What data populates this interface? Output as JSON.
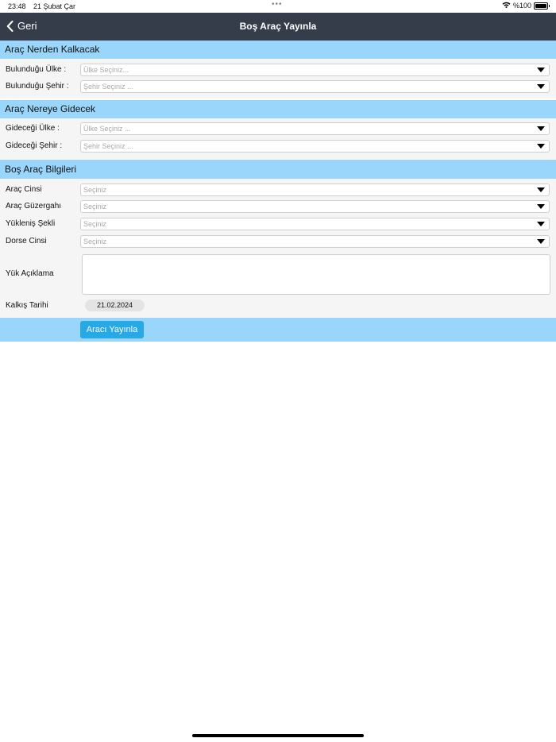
{
  "status_bar": {
    "time": "23:48",
    "date": "21 Şubat Çar",
    "dots": "•••",
    "battery_text": "%100"
  },
  "nav": {
    "back_label": "Geri",
    "title": "Boş Araç Yayınla"
  },
  "from_section": {
    "title": "Araç Nerden Kalkacak",
    "country_label": "Bulunduğu Ülke :",
    "country_placeholder": "Ülke Seçiniz...",
    "city_label": "Bulunduğu Şehir :",
    "city_placeholder": "Şehir Seçiniz ..."
  },
  "to_section": {
    "title": "Araç Nereye Gidecek",
    "country_label": "Gideceği Ülke :",
    "country_placeholder": "Ülke Seçiniz ...",
    "city_label": "Gideceği Şehir :",
    "city_placeholder": "Şehir Seçiniz ..."
  },
  "info_section": {
    "title": "Boş Araç Bilgileri",
    "fields": [
      {
        "label": "Araç Cinsi",
        "placeholder": "Seçiniz"
      },
      {
        "label": "Araç Güzergahı",
        "placeholder": "Seçiniz"
      },
      {
        "label": "Yükleniş Şekli",
        "placeholder": "Seçiniz"
      },
      {
        "label": "Dorse Cinsi",
        "placeholder": "Seçiniz"
      }
    ],
    "description_label": "Yük Açıklama",
    "departure_label": "Kalkış Tarihi",
    "departure_date": "21.02.2024"
  },
  "actions": {
    "publish_label": "Aracı Yayınla"
  }
}
